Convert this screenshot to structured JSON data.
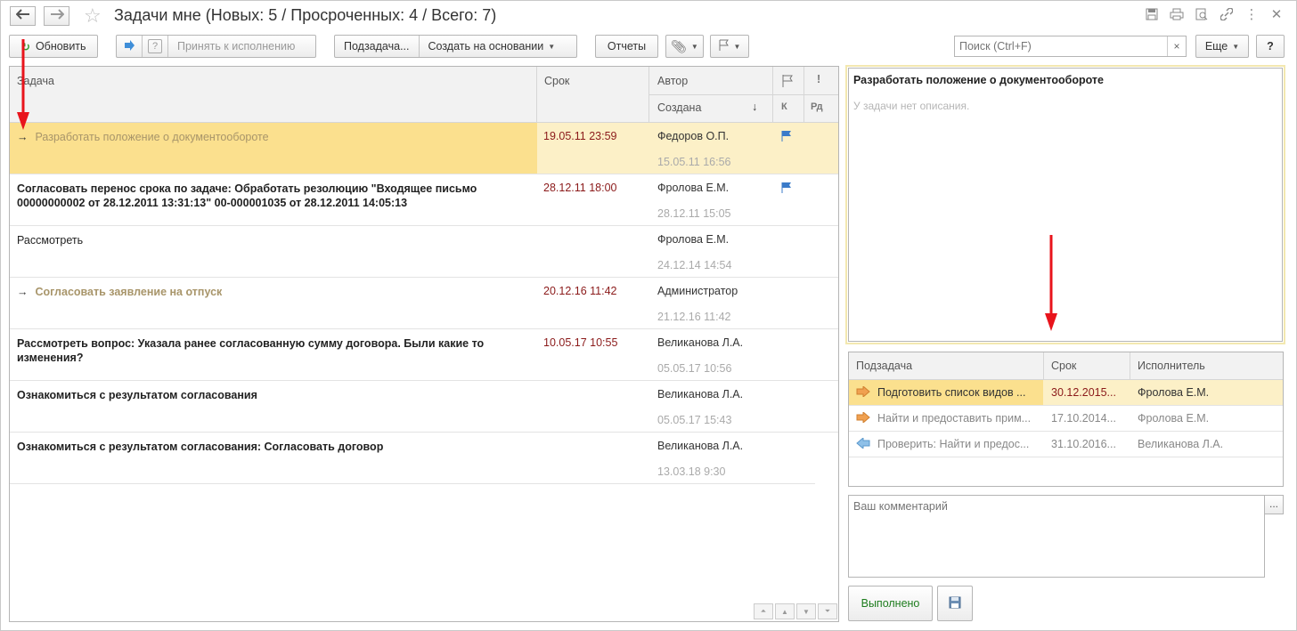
{
  "window": {
    "title": "Задачи мне (Новых: 5 / Просроченных: 4 / Всего: 7)",
    "back_icon": "arrow-left-icon",
    "forward_icon": "arrow-right-icon",
    "favorite_icon": "star-icon",
    "window_icons": [
      "save-icon",
      "print-icon",
      "preview-icon",
      "link-icon",
      "menu-icon",
      "close-icon"
    ]
  },
  "toolbar": {
    "refresh": "Обновить",
    "accept": "Принять к исполнению",
    "subtask": "Подзадача...",
    "create_based": "Создать на основании",
    "reports": "Отчеты",
    "more": "Еще",
    "help": "?",
    "search_placeholder": "Поиск (Ctrl+F)",
    "search_clear": "×"
  },
  "list": {
    "columns": {
      "task": "Задача",
      "due": "Срок",
      "author": "Автор",
      "created": "Создана",
      "sort_arrow": "↓",
      "k": "К",
      "rd": "Рд",
      "important": "!"
    },
    "rows": [
      {
        "task": "Разработать положение о документообороте",
        "due": "19.05.11 23:59",
        "author": "Федоров О.П.",
        "created": "15.05.11 16:56",
        "flag": true,
        "style": "faded",
        "arrow": true,
        "selected": true
      },
      {
        "task": "Согласовать перенос срока по задаче: Обработать резолюцию \"Входящее письмо 00000000002 от 28.12.2011 13:31:13\" 00-000001035 от 28.12.2011 14:05:13",
        "due": "28.12.11 18:00",
        "author": "Фролова Е.М.",
        "created": "28.12.11 15:05",
        "flag": true,
        "style": "bold",
        "arrow": false,
        "selected": false
      },
      {
        "task": "Рассмотреть",
        "due": "",
        "author": "Фролова Е.М.",
        "created": "24.12.14 14:54",
        "flag": false,
        "style": "normal",
        "arrow": false,
        "selected": false
      },
      {
        "task": "Согласовать заявление на отпуск",
        "due": "20.12.16 11:42",
        "author": "Администратор",
        "created": "21.12.16 11:42",
        "flag": false,
        "style": "goldbold",
        "arrow": true,
        "selected": false
      },
      {
        "task": "Рассмотреть вопрос: Указала ранее согласованную сумму договора. Были какие то изменения?",
        "due": "10.05.17 10:55",
        "author": "Великанова Л.А.",
        "created": "05.05.17 10:56",
        "flag": false,
        "style": "bold",
        "arrow": false,
        "selected": false
      },
      {
        "task": "Ознакомиться с результатом согласования",
        "due": "",
        "author": "Великанова Л.А.",
        "created": "05.05.17 15:43",
        "flag": false,
        "style": "bold",
        "arrow": false,
        "selected": false
      },
      {
        "task": "Ознакомиться с результатом согласования: Согласовать договор",
        "due": "",
        "author": "Великанова Л.А.",
        "created": "13.03.18 9:30",
        "flag": false,
        "style": "bold",
        "arrow": false,
        "selected": false
      }
    ]
  },
  "description": {
    "title": "Разработать положение о документообороте",
    "empty": "У задачи нет описания."
  },
  "subtasks": {
    "columns": {
      "name": "Подзадача",
      "due": "Срок",
      "executor": "Исполнитель"
    },
    "rows": [
      {
        "name": "Подготовить список видов ...",
        "due": "30.12.2015...",
        "executor": "Фролова Е.М.",
        "icon": "arrow-right-orange-icon"
      },
      {
        "name": "Найти и предоставить прим...",
        "due": "17.10.2014...",
        "executor": "Фролова Е.М.",
        "icon": "arrow-right-orange-icon"
      },
      {
        "name": "Проверить: Найти и предос...",
        "due": "31.10.2016...",
        "executor": "Великанова Л.А.",
        "icon": "arrow-left-blue-icon"
      }
    ]
  },
  "comment": {
    "placeholder": "Ваш комментарий",
    "more": "..."
  },
  "actions": {
    "done": "Выполнено"
  },
  "colors": {
    "selection": "#fbe08e",
    "selection_row": "#fcf0c7",
    "due_text": "#8b1a1a",
    "flag": "#3b7bc9",
    "annotation_arrow": "#e8141c"
  }
}
